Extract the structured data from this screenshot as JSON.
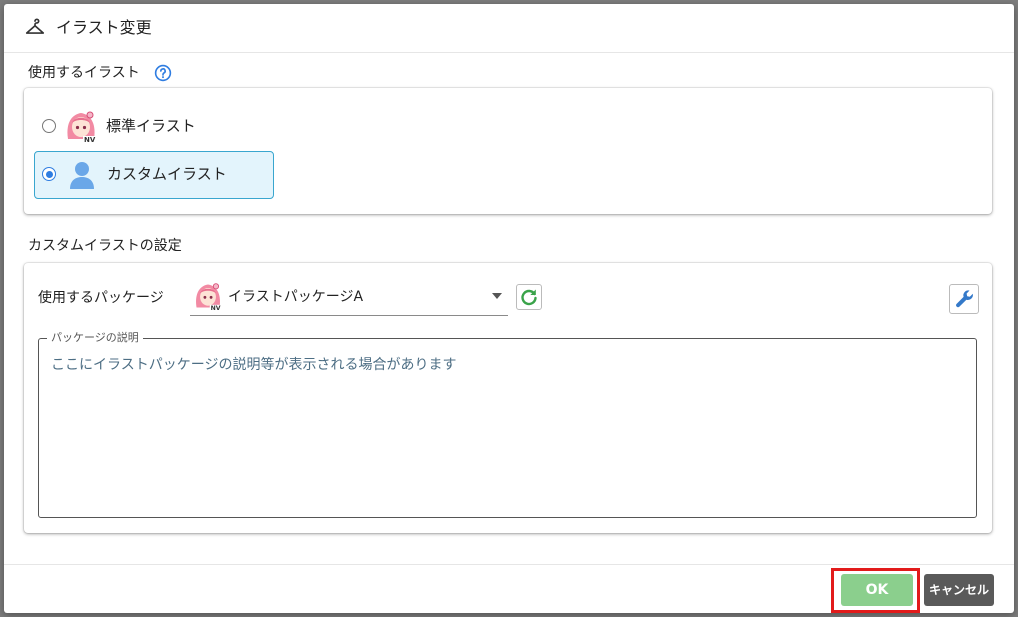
{
  "dialog": {
    "title": "イラスト変更",
    "title_icon": "hanger-icon"
  },
  "illustration_section": {
    "label": "使用するイラスト",
    "help_icon": "help-circle-icon",
    "options": [
      {
        "label": "標準イラスト",
        "icon": "character-thumbnail-icon",
        "selected": false
      },
      {
        "label": "カスタムイラスト",
        "icon": "person-icon",
        "selected": true
      }
    ]
  },
  "custom_section": {
    "label": "カスタムイラストの設定",
    "package_label": "使用するパッケージ",
    "package_selected": "イラストパッケージA",
    "description_legend": "パッケージの説明",
    "description_text": "ここにイラストパッケージの説明等が表示される場合があります"
  },
  "footer": {
    "ok_label": "OK",
    "cancel_label": "キャンセル"
  },
  "colors": {
    "selected_bg": "#e3f4fc",
    "selected_border": "#39a6cf",
    "ok_button": "#8bcf8d",
    "cancel_button": "#5a5a5a",
    "highlight": "#e21b1b"
  }
}
